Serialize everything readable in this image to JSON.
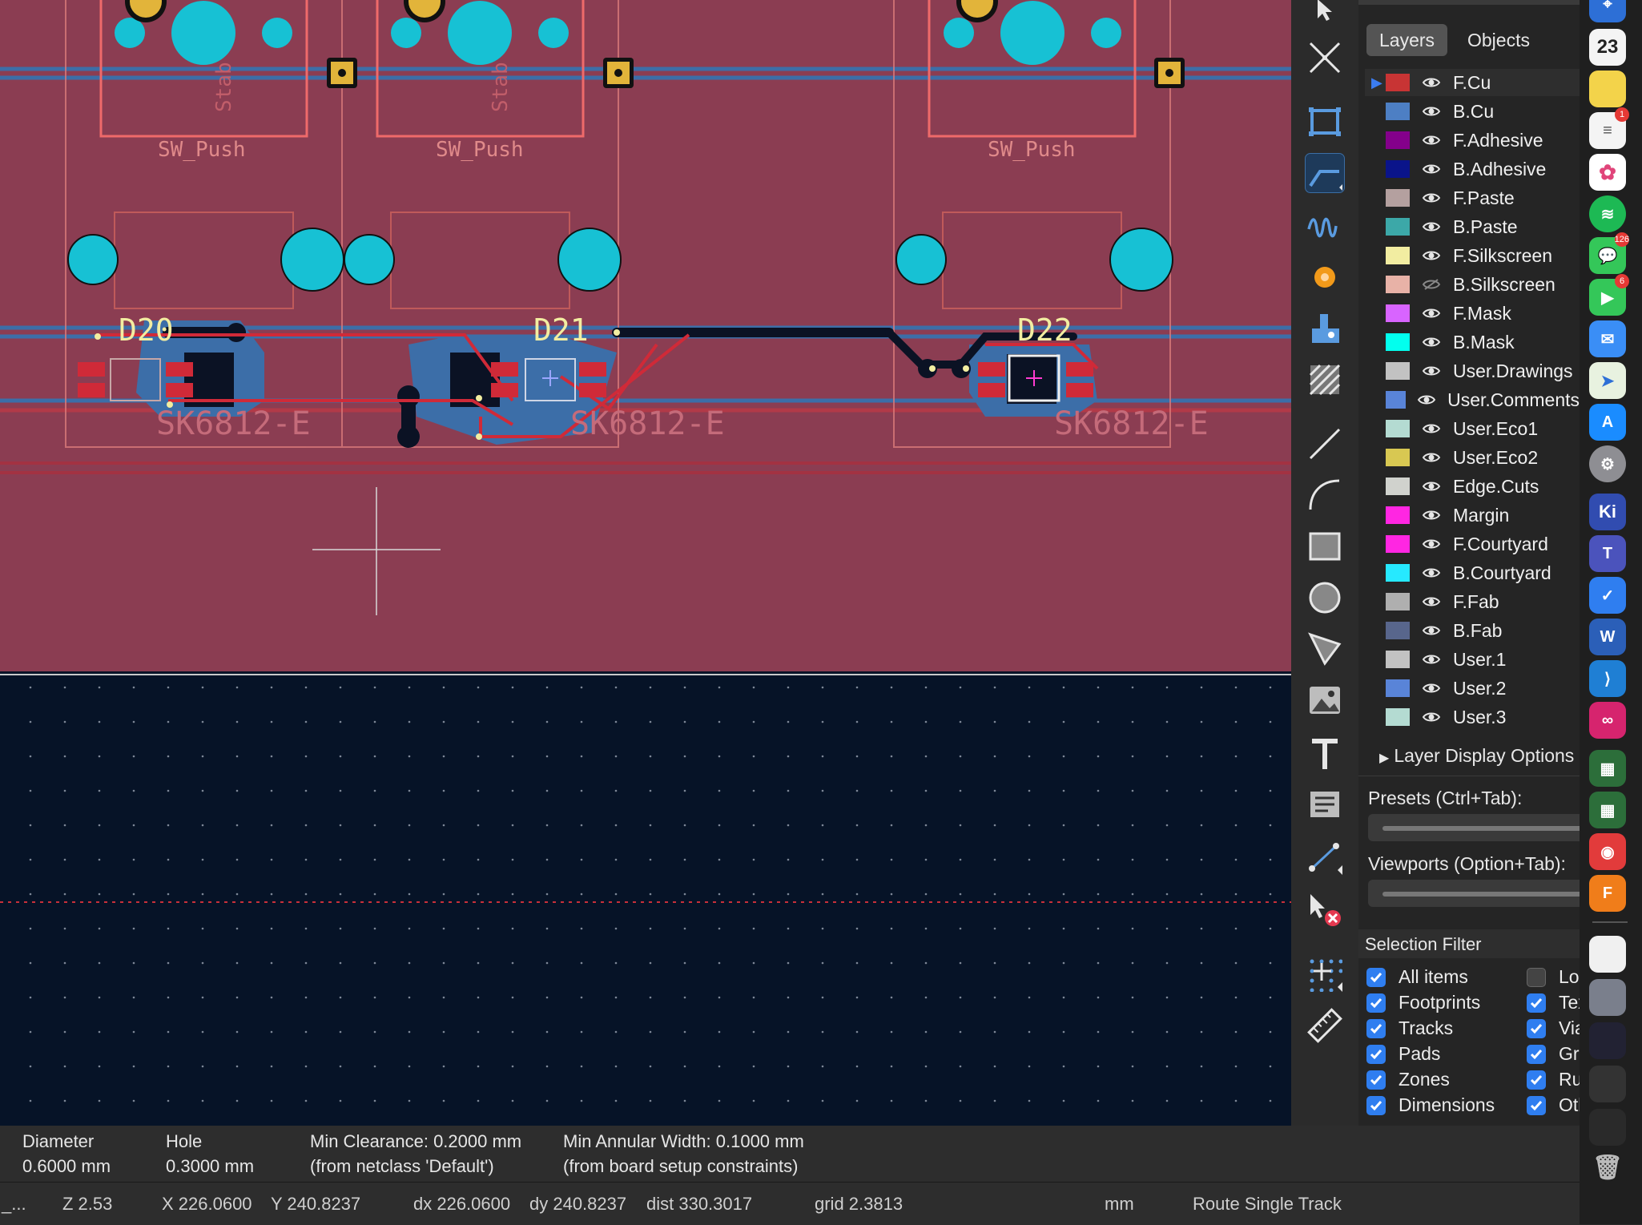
{
  "pcb": {
    "refs": [
      "D20",
      "D21",
      "D22"
    ],
    "switch_value": "SW_Push",
    "led_value": "SK6812-E",
    "stab_label": "Stab"
  },
  "panel": {
    "tabs": [
      "Layers",
      "Objects"
    ],
    "layers": [
      {
        "name": "F.Cu",
        "color": "#c83434",
        "active": true
      },
      {
        "name": "B.Cu",
        "color": "#4d7fc4"
      },
      {
        "name": "F.Adhesive",
        "color": "#84008b"
      },
      {
        "name": "B.Adhesive",
        "color": "#0a148a"
      },
      {
        "name": "F.Paste",
        "color": "#b4a09f"
      },
      {
        "name": "B.Paste",
        "color": "#3ca8a8"
      },
      {
        "name": "F.Silkscreen",
        "color": "#f2eda1"
      },
      {
        "name": "B.Silkscreen",
        "color": "#e8b2a7",
        "hidden": true
      },
      {
        "name": "F.Mask",
        "color": "#d864ff"
      },
      {
        "name": "B.Mask",
        "color": "#02ffee"
      },
      {
        "name": "User.Drawings",
        "color": "#c2c2c2"
      },
      {
        "name": "User.Comments",
        "color": "#5984d8"
      },
      {
        "name": "User.Eco1",
        "color": "#b4dbd2"
      },
      {
        "name": "User.Eco2",
        "color": "#d8c852"
      },
      {
        "name": "Edge.Cuts",
        "color": "#d0d2cd"
      },
      {
        "name": "Margin",
        "color": "#ff26e2"
      },
      {
        "name": "F.Courtyard",
        "color": "#ff26e2"
      },
      {
        "name": "B.Courtyard",
        "color": "#26e9ff"
      },
      {
        "name": "F.Fab",
        "color": "#afafaf"
      },
      {
        "name": "B.Fab",
        "color": "#58668c"
      },
      {
        "name": "User.1",
        "color": "#c2c2c2"
      },
      {
        "name": "User.2",
        "color": "#5984d8"
      },
      {
        "name": "User.3",
        "color": "#b4dbd2"
      }
    ],
    "layer_display_options": "Layer Display Options",
    "presets_label": "Presets (Ctrl+Tab):",
    "viewports_label": "Viewports (Option+Tab):",
    "selection_filter": "Selection Filter",
    "filters_left": [
      {
        "label": "All items",
        "checked": true
      },
      {
        "label": "Footprints",
        "checked": true
      },
      {
        "label": "Tracks",
        "checked": true
      },
      {
        "label": "Pads",
        "checked": true
      },
      {
        "label": "Zones",
        "checked": true
      },
      {
        "label": "Dimensions",
        "checked": true
      }
    ],
    "filters_right": [
      {
        "label": "Locked items",
        "checked": false
      },
      {
        "label": "Text",
        "checked": true
      },
      {
        "label": "Vias",
        "checked": true
      },
      {
        "label": "Graphics",
        "checked": true
      },
      {
        "label": "Rule Areas",
        "checked": true
      },
      {
        "label": "Other items",
        "checked": true
      }
    ]
  },
  "message_panel": {
    "diameter_label": "Diameter",
    "diameter_value": "0.6000 mm",
    "hole_label": "Hole",
    "hole_value": "0.3000 mm",
    "clearance_label": "Min Clearance: 0.2000 mm",
    "clearance_source": "(from netclass 'Default')",
    "annular_label": "Min Annular Width: 0.1000 mm",
    "annular_source": "(from board setup constraints)"
  },
  "status": {
    "file": "_...",
    "zoom": "Z 2.53",
    "x": "X 226.0600",
    "y": "Y 240.8237",
    "dx": "dx 226.0600",
    "dy": "dy 240.8237",
    "dist": "dist 330.3017",
    "grid": "grid 2.3813",
    "units": "mm",
    "mode": "Route Single Track"
  },
  "dock": {
    "calendar_day": "23",
    "reminders_badge": "1",
    "messages_badge": "126",
    "facetime_badge": "6",
    "kicad_letters": "Ki",
    "fusion_letter": "F"
  },
  "colors": {
    "board_fill": "#8b3d52",
    "background": "#061327",
    "pad_cyan": "#17c1d4",
    "copper_red": "#d02a38",
    "copper_blue": "#3c6ea8"
  }
}
